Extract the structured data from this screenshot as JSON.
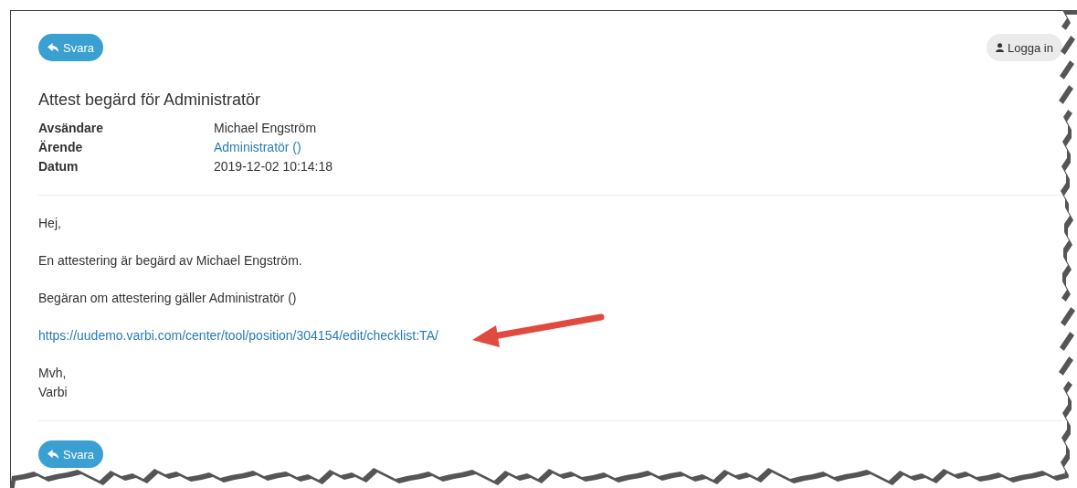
{
  "header": {
    "reply_button": "Svara",
    "login_button": "Logga in"
  },
  "title": "Attest begärd för Administratör",
  "meta": [
    {
      "label": "Avsändare",
      "value": "Michael Engström",
      "kind": "text"
    },
    {
      "label": "Ärende",
      "value": "Administratör ()",
      "kind": "link"
    },
    {
      "label": "Datum",
      "value": "2019-12-02 10:14:18",
      "kind": "text"
    }
  ],
  "body": [
    {
      "kind": "text",
      "lines": [
        "Hej,"
      ]
    },
    {
      "kind": "text",
      "lines": [
        "En attestering är begärd av Michael Engström."
      ]
    },
    {
      "kind": "text",
      "lines": [
        "Begäran om attestering gäller Administratör ()"
      ]
    },
    {
      "kind": "link",
      "lines": [
        "https://uudemo.varbi.com/center/tool/position/304154/edit/checklist:TA/"
      ]
    },
    {
      "kind": "text",
      "lines": [
        "Mvh,",
        "Varbi"
      ]
    }
  ],
  "footer": {
    "reply_button": "Svara"
  }
}
